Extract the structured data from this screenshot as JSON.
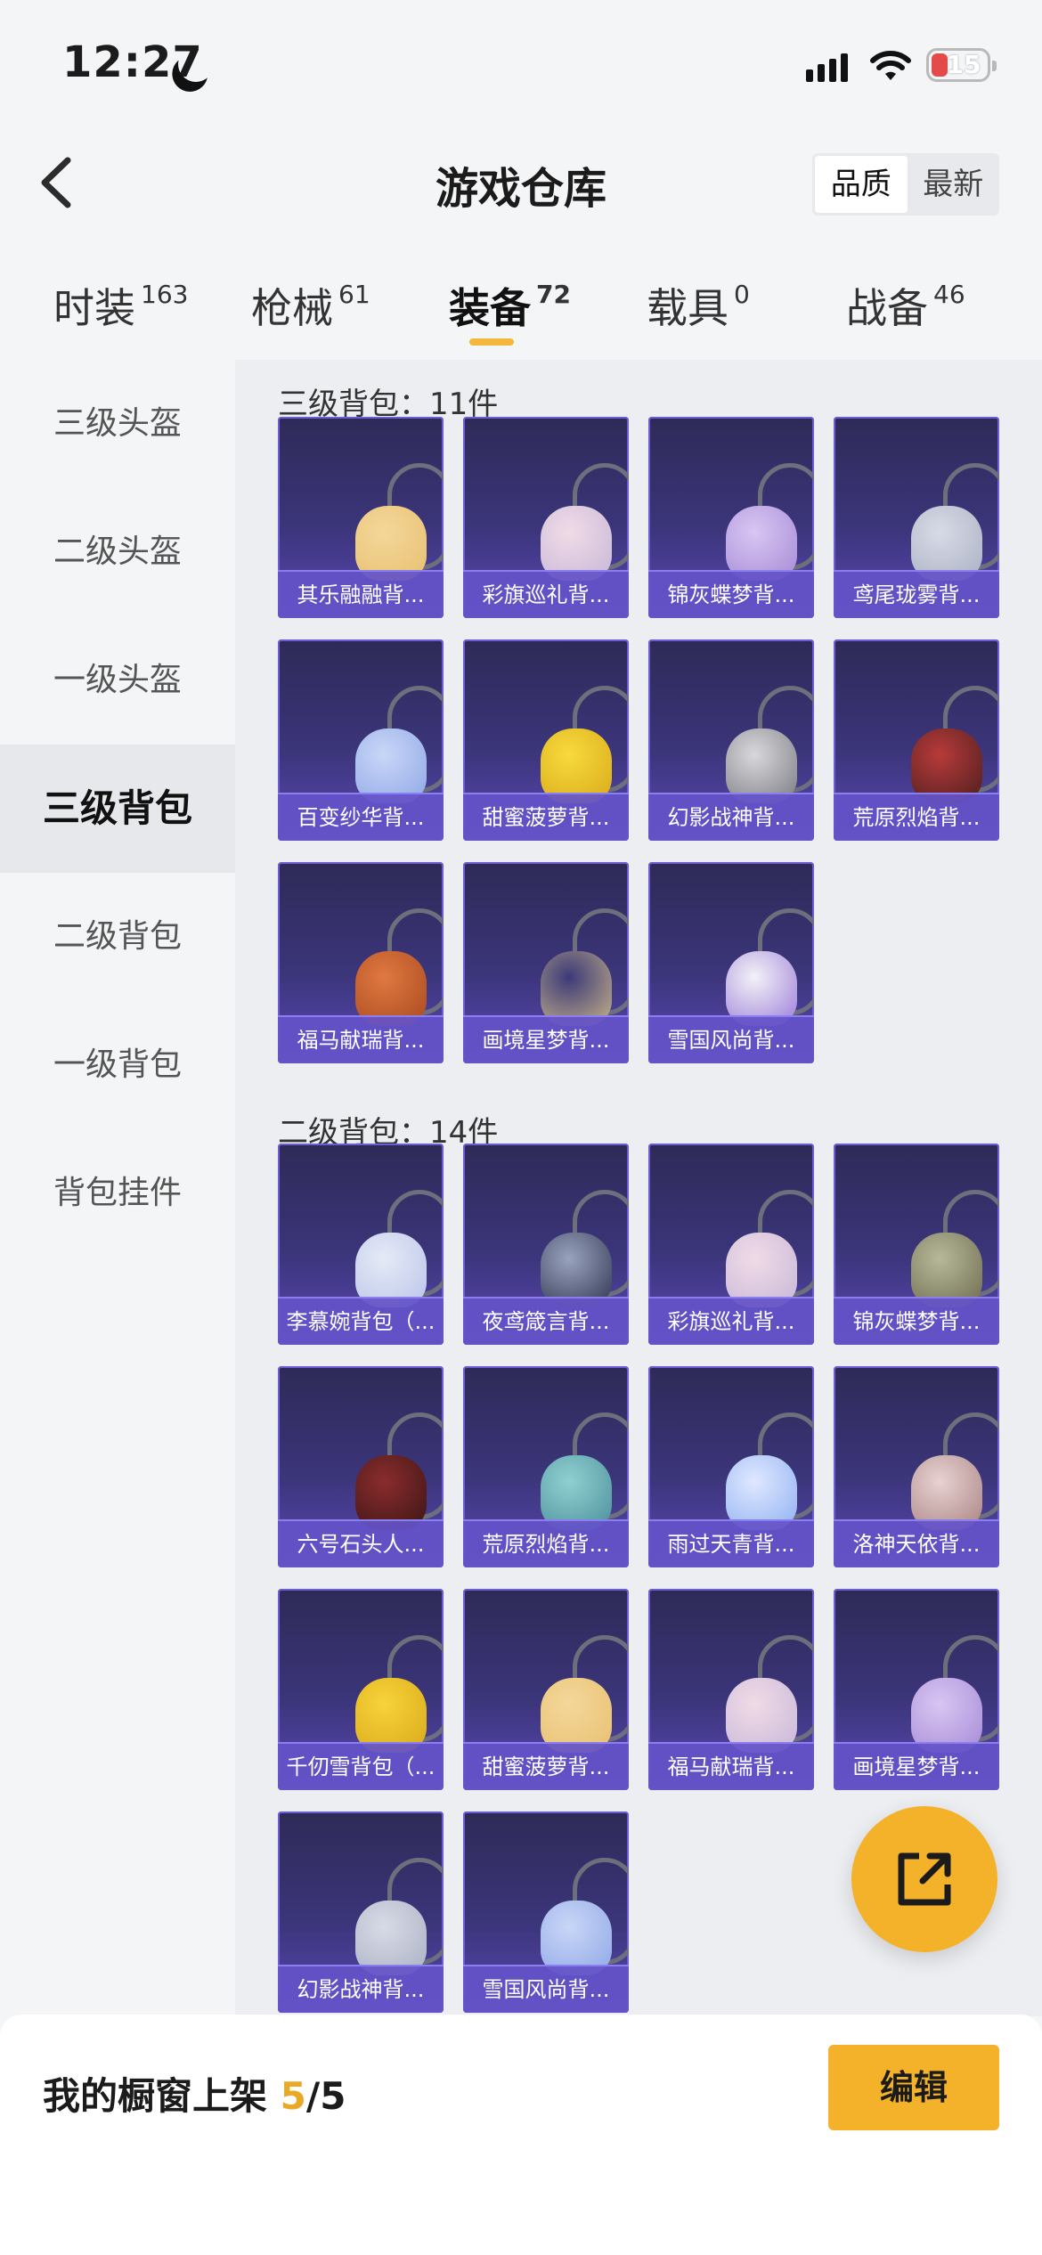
{
  "status_bar": {
    "time": "12:27",
    "battery": "15"
  },
  "header": {
    "title": "游戏仓库",
    "sort_options": [
      "品质",
      "最新"
    ],
    "active_sort": "品质"
  },
  "tabs": [
    {
      "label": "时装",
      "count": "163"
    },
    {
      "label": "枪械",
      "count": "61"
    },
    {
      "label": "装备",
      "count": "72",
      "active": true
    },
    {
      "label": "载具",
      "count": "0"
    },
    {
      "label": "战备",
      "count": "46"
    }
  ],
  "sidebar": {
    "items": [
      "三级头盔",
      "二级头盔",
      "一级头盔",
      "三级背包",
      "二级背包",
      "一级背包",
      "背包挂件"
    ],
    "active": "三级背包"
  },
  "sections": [
    {
      "title": "三级背包：11件",
      "items": [
        "其乐融融背...",
        "彩旗巡礼背...",
        "锦灰蝶梦背...",
        "鸢尾珑雾背...",
        "百变纱华背...",
        "甜蜜菠萝背...",
        "幻影战神背...",
        "荒原烈焰背...",
        "福马献瑞背...",
        "画境星梦背...",
        "雪国风尚背..."
      ]
    },
    {
      "title": "二级背包：14件",
      "items": [
        "李慕婉背包（...",
        "夜鸢箴言背...",
        "彩旗巡礼背...",
        "锦灰蝶梦背...",
        "六号石头人...",
        "荒原烈焰背...",
        "雨过天青背...",
        "洛神天依背...",
        "千仞雪背包（...",
        "甜蜜菠萝背...",
        "福马献瑞背...",
        "画境星梦背...",
        "幻影战神背...",
        "雪国风尚背..."
      ]
    }
  ],
  "bottom_bar": {
    "label": "我的橱窗上架",
    "count_current": "5",
    "count_total": "/5",
    "edit_label": "编辑"
  },
  "colors": {
    "accent": "#f4b12a",
    "card_bg": "#3b357a",
    "card_label": "#6452c8"
  },
  "icons": {
    "back": "chevron-left-icon",
    "share": "share-icon",
    "moon": "moon-icon",
    "wifi": "wifi-icon",
    "signal": "cellular-signal-icon",
    "battery": "battery-icon"
  }
}
